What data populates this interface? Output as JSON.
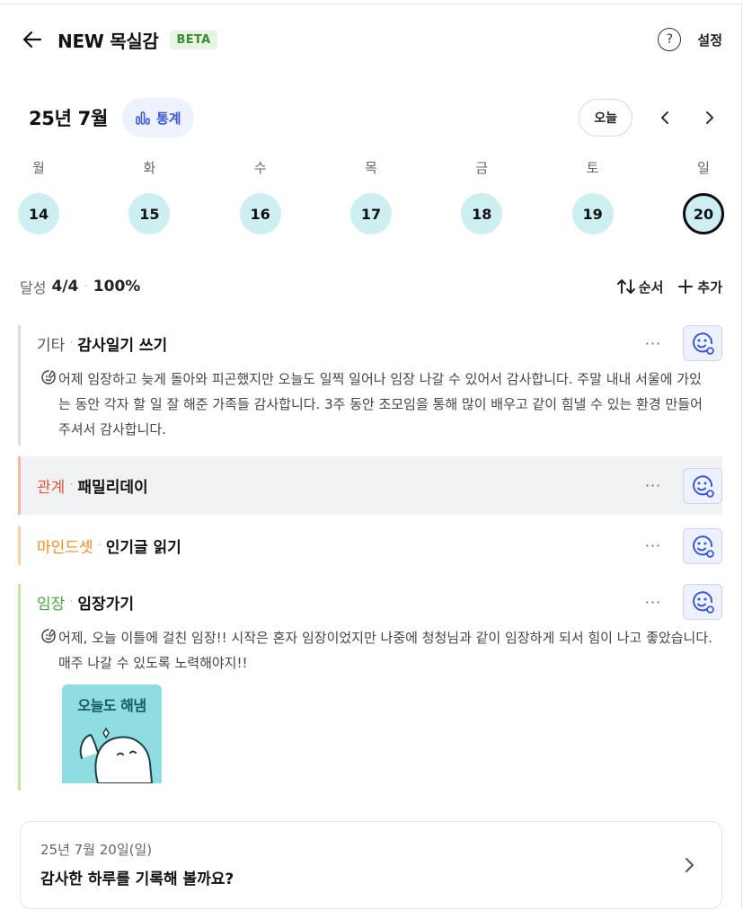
{
  "header": {
    "title": "NEW 목실감",
    "badge": "BETA",
    "help_symbol": "?",
    "settings_label": "설정"
  },
  "calendar": {
    "month_label": "25년 7월",
    "stats_label": "통계",
    "today_label": "오늘",
    "weekdays": [
      "월",
      "화",
      "수",
      "목",
      "금",
      "토",
      "일"
    ],
    "dates": [
      "14",
      "15",
      "16",
      "17",
      "18",
      "19",
      "20"
    ],
    "selected_date": "20"
  },
  "summary": {
    "achieve_label": "달성",
    "achieve_count": "4/4",
    "separator": "·",
    "achieve_percent": "100%",
    "order_label": "순서",
    "add_label": "추가"
  },
  "items": [
    {
      "category": "기타",
      "name": "감사일기 쓰기",
      "memo": "어제 임장하고 늦게 돌아와 피곤했지만 오늘도 일찍 일어나 임장 나갈 수 있어서 감사합니다. 주말 내내 서울에 가있는 동안 각자 할 일 잘 해준 가족들 감사합니다. 3주 동안 조모임을 통해 많이 배우고 같이 힘낼 수 있는 환경 만들어주셔서 감사합니다."
    },
    {
      "category": "관계",
      "name": "패밀리데이"
    },
    {
      "category": "마인드셋",
      "name": "인기글 읽기"
    },
    {
      "category": "임장",
      "name": "임장가기",
      "memo": "어제, 오늘 이틀에 걸친 임장!! 시작은 혼자 임장이었지만 나중에 청청님과 같이 임장하게 되서 힘이 나고 좋았습니다. 매주 나갈 수 있도록 노력해야지!!",
      "photo_text": "오늘도 해냄"
    }
  ],
  "record_card": {
    "date": "25년 7월 20일(일)",
    "prompt": "감사한 하루를 기록해 볼까요?"
  },
  "colors": {
    "category_etc": "#555555",
    "category_relation": "#e0553f",
    "category_mindset": "#ef8b1f",
    "category_gym": "#4aa83a",
    "accent": "#3a57d6",
    "date_circle": "#cdeff1"
  },
  "icons": [
    "back-arrow-icon",
    "help-icon",
    "bar-chart-icon",
    "chevron-left-icon",
    "chevron-right-icon",
    "sort-icon",
    "plus-icon",
    "more-icon",
    "smile-reaction-icon",
    "memo-icon"
  ]
}
